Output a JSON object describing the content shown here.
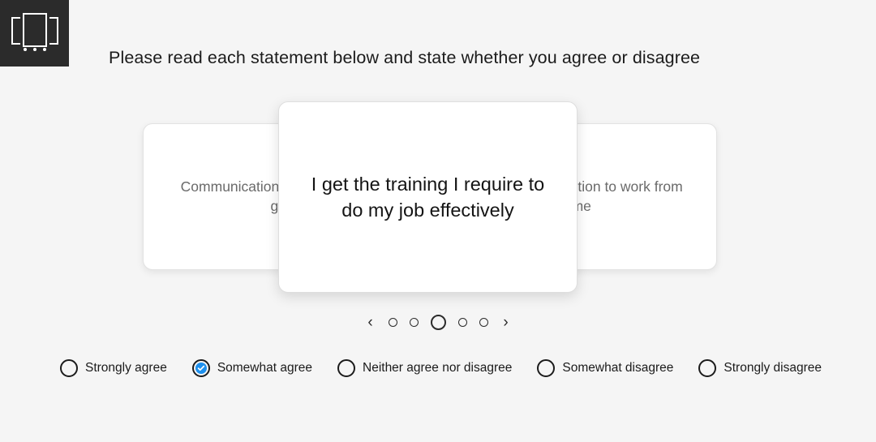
{
  "app": {
    "logo_name": "survey-app-logo",
    "logo_background": "#2b2b2b",
    "page_background": "#f5f5f5"
  },
  "header": {
    "title": "Please read each statement below and state whether you agree or disagree"
  },
  "carousel": {
    "prev_arrow": "‹",
    "next_arrow": "›",
    "active_index": 2,
    "total": 5,
    "cards": [
      {
        "position": "previous",
        "text": "Communication within my team is good"
      },
      {
        "position": "active",
        "text": "I get the training I require to do my job effectively"
      },
      {
        "position": "next",
        "text": "I would like the option to work from home"
      }
    ],
    "dots": [
      {
        "active": false
      },
      {
        "active": false
      },
      {
        "active": true
      },
      {
        "active": false
      },
      {
        "active": false
      }
    ]
  },
  "options": {
    "selected_index": 1,
    "selected_color": "#1e90ed",
    "items": [
      {
        "label": "Strongly agree",
        "selected": false
      },
      {
        "label": "Somewhat agree",
        "selected": true
      },
      {
        "label": "Neither agree nor disagree",
        "selected": false
      },
      {
        "label": "Somewhat disagree",
        "selected": false
      },
      {
        "label": "Strongly disagree",
        "selected": false
      }
    ]
  }
}
